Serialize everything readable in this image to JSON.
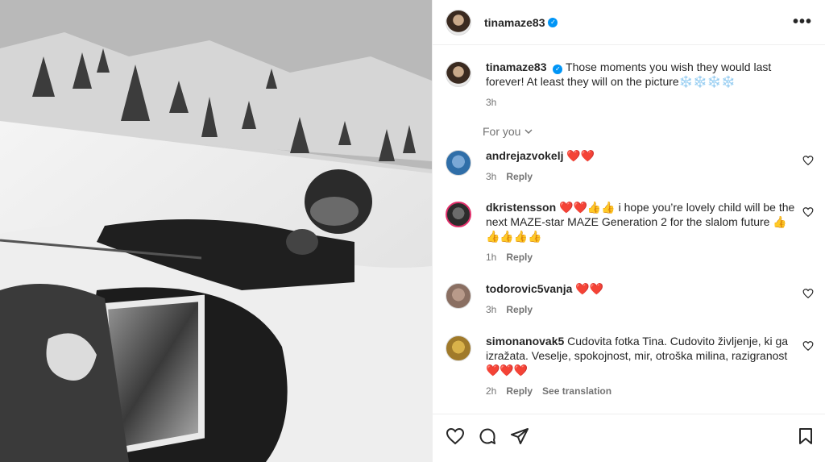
{
  "post_owner": {
    "username": "tinamaze83",
    "verified_mark": "✓"
  },
  "caption": {
    "username": "tinamaze83",
    "text": "Those moments you wish they would last forever! At least they will on the picture❄️❄️❄️❄️",
    "time": "3h"
  },
  "filter": {
    "label": "For you"
  },
  "comments": [
    {
      "username": "andrejazvokelj",
      "text": "❤️❤️",
      "time": "3h",
      "reply": "Reply"
    },
    {
      "username": "dkristensson",
      "text": "❤️❤️👍👍 i hope you’re lovely child will be the next MAZE-star MAZE Generation 2 for the slalom future 👍👍👍👍👍",
      "time": "1h",
      "reply": "Reply"
    },
    {
      "username": "todorovic5vanja",
      "text": "❤️❤️",
      "time": "3h",
      "reply": "Reply"
    },
    {
      "username": "simonanovak5",
      "text": "Cudovita fotka Tina. Cudovito življenje, ki ga izražata. Veselje, spokojnost, mir, otroška milina, razigranost❤️❤️❤️",
      "time": "2h",
      "reply": "Reply",
      "translate": "See translation"
    }
  ],
  "icons": {
    "like": "heart-icon",
    "comment": "comment-icon",
    "share": "paper-plane-icon",
    "save": "bookmark-icon",
    "more": "more-options-icon"
  },
  "colors": {
    "verified": "#0095f6",
    "secondary_text": "#737373",
    "border": "#efefef"
  }
}
